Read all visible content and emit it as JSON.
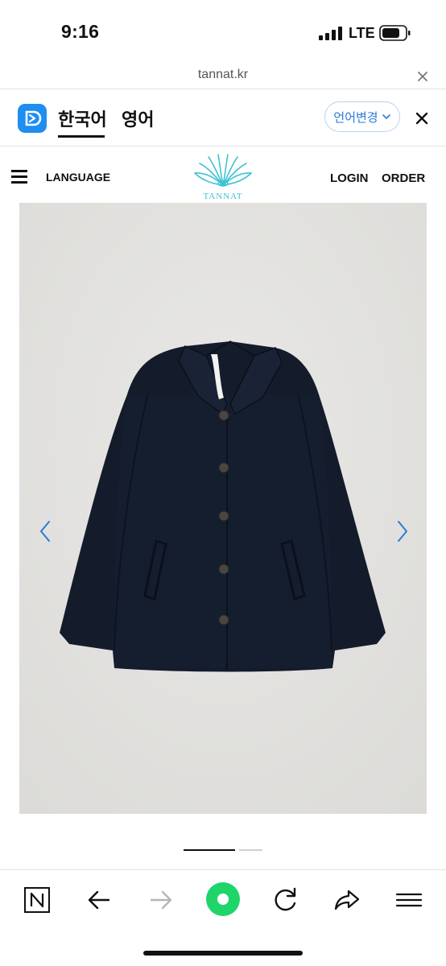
{
  "status_bar": {
    "time": "9:16",
    "network": "LTE"
  },
  "browser": {
    "url": "tannat.kr"
  },
  "translate_bar": {
    "lang_korean": "한국어",
    "lang_english": "영어",
    "change_language": "언어변경"
  },
  "site_header": {
    "language": "LANGUAGE",
    "logo_text": "TANNAT",
    "login": "LOGIN",
    "order": "ORDER"
  },
  "carousel": {
    "slide_count": 2,
    "active_slide": 1
  },
  "colors": {
    "accent_blue": "#1e8ef0",
    "link_blue": "#2a7ad9",
    "logo_teal": "#3ec3d3",
    "naver_green": "#1fd56a",
    "jacket_navy": "#141b2b"
  },
  "toolbar": {
    "icons": [
      "naver-n-icon",
      "back-icon",
      "forward-icon",
      "green-dot-icon",
      "refresh-icon",
      "share-icon",
      "menu-icon"
    ]
  }
}
